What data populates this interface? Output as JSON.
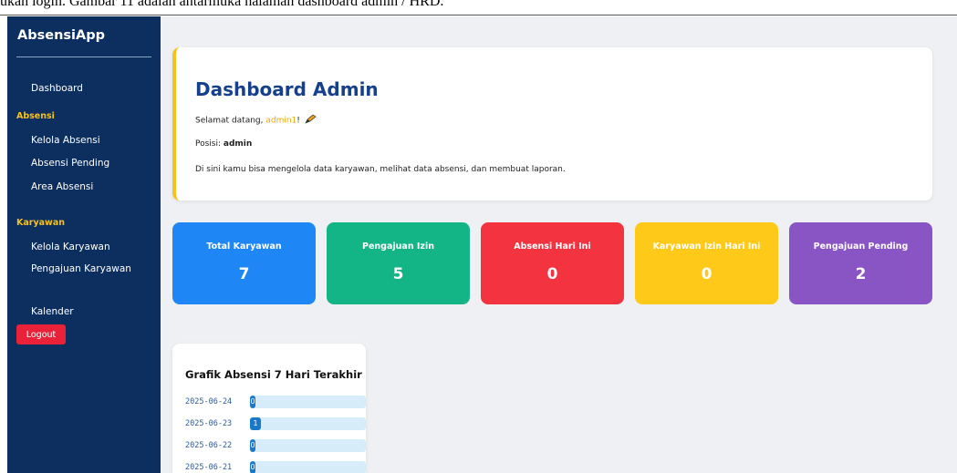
{
  "caption": "ukan login. Gambar 11 adalah antarmuka halaman dashboard admin / HRD.",
  "sidebar": {
    "brand": "AbsensiApp",
    "dashboard": "Dashboard",
    "section_absensi": "Absensi",
    "kelola_absensi": "Kelola Absensi",
    "absensi_pending": "Absensi Pending",
    "area_absensi": "Area Absensi",
    "section_karyawan": "Karyawan",
    "kelola_karyawan": "Kelola Karyawan",
    "pengajuan_karyawan": "Pengajuan Karyawan",
    "kalender": "Kalender",
    "logout": "Logout"
  },
  "welcome": {
    "title": "Dashboard Admin",
    "greeting_prefix": "Selamat datang, ",
    "username": "admin1",
    "greeting_suffix": "!",
    "position_label": "Posisi: ",
    "position_value": "admin",
    "description": "Di sini kamu bisa mengelola data karyawan, melihat data absensi, dan membuat laporan."
  },
  "cards": [
    {
      "title": "Total Karyawan",
      "value": "7",
      "color": "#1f86f5"
    },
    {
      "title": "Pengajuan Izin",
      "value": "5",
      "color": "#13b586"
    },
    {
      "title": "Absensi Hari Ini",
      "value": "0",
      "color": "#f33340"
    },
    {
      "title": "Karyawan Izin Hari Ini",
      "value": "0",
      "color": "#ffc91a"
    },
    {
      "title": "Pengajuan Pending",
      "value": "2",
      "color": "#8955c5"
    }
  ],
  "chart": {
    "title": "Grafik Absensi 7 Hari Terakhir",
    "rows": [
      {
        "date": "2025-06-24",
        "value": 0
      },
      {
        "date": "2025-06-23",
        "value": 1
      },
      {
        "date": "2025-06-22",
        "value": 0
      },
      {
        "date": "2025-06-21",
        "value": 0
      }
    ]
  },
  "colors": {
    "sidebar_bg": "#0d2f5f",
    "accent_yellow": "#f7c21a",
    "title_blue": "#16408c",
    "logout_red": "#e9223a"
  }
}
